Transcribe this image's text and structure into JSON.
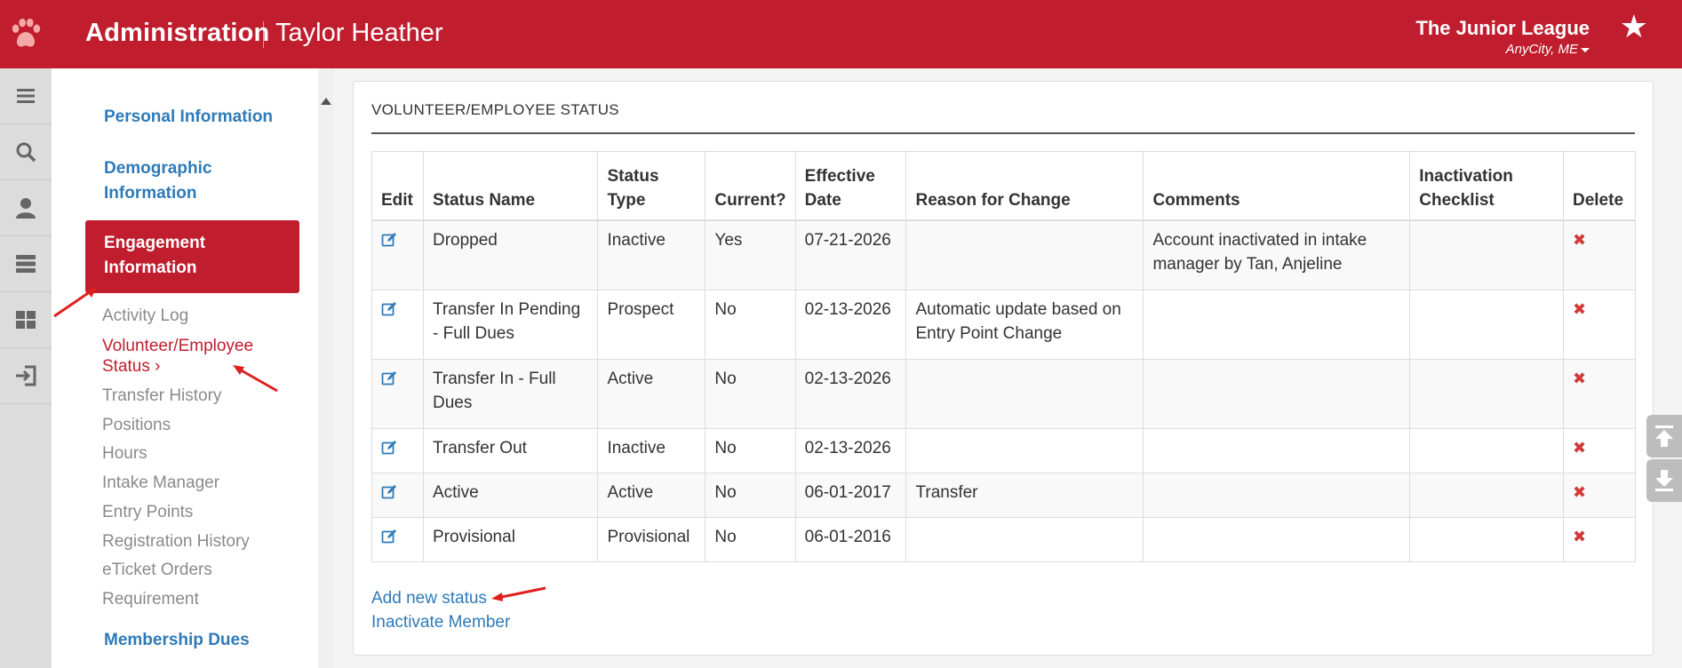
{
  "header": {
    "app_title": "Administration",
    "user_name": "Taylor Heather",
    "org_name": "The Junior League",
    "org_location": "AnyCity, ME",
    "brand_color": "#c01d2e"
  },
  "rail": {
    "icons": [
      "menu-icon",
      "search-icon",
      "user-icon",
      "server-icon",
      "dashboard-icon",
      "logout-icon"
    ]
  },
  "subnav": {
    "personal_information": "Personal Information",
    "demographic_information_line1": "Demographic",
    "demographic_information_line2": "Information",
    "engagement_information_line1": "Engagement",
    "engagement_information_line2": "Information",
    "items": [
      "Activity Log",
      "Volunteer/Employee",
      "Transfer History",
      "Positions",
      "Hours",
      "Intake Manager",
      "Entry Points",
      "Registration History",
      "eTicket Orders",
      "Requirement"
    ],
    "current_item_line2": "Status ›",
    "membership_dues": "Membership Dues"
  },
  "panel": {
    "title": "VOLUNTEER/EMPLOYEE STATUS",
    "columns": {
      "edit": "Edit",
      "status_name": "Status Name",
      "status_type_1": "Status",
      "status_type_2": "Type",
      "current": "Current?",
      "effective_1": "Effective",
      "effective_2": "Date",
      "reason": "Reason for Change",
      "comments": "Comments",
      "inactivation_1": "Inactivation",
      "inactivation_2": "Checklist",
      "delete": "Delete"
    },
    "rows": [
      {
        "status_name": "Dropped",
        "status_type": "Inactive",
        "current": "Yes",
        "effective_date": "07-21-2026",
        "reason": "",
        "comments": "Account inactivated in intake manager by Tan, Anjeline",
        "checklist": ""
      },
      {
        "status_name": "Transfer In Pending - Full Dues",
        "status_type": "Prospect",
        "current": "No",
        "effective_date": "02-13-2026",
        "reason": "Automatic update based on Entry Point Change",
        "comments": "",
        "checklist": ""
      },
      {
        "status_name": "Transfer In - Full Dues",
        "status_type": "Active",
        "current": "No",
        "effective_date": "02-13-2026",
        "reason": "",
        "comments": "",
        "checklist": ""
      },
      {
        "status_name": "Transfer Out",
        "status_type": "Inactive",
        "current": "No",
        "effective_date": "02-13-2026",
        "reason": "",
        "comments": "",
        "checklist": ""
      },
      {
        "status_name": "Active",
        "status_type": "Active",
        "current": "No",
        "effective_date": "06-01-2017",
        "reason": "Transfer",
        "comments": "",
        "checklist": ""
      },
      {
        "status_name": "Provisional",
        "status_type": "Provisional",
        "current": "No",
        "effective_date": "06-01-2016",
        "reason": "",
        "comments": "",
        "checklist": ""
      }
    ],
    "add_new_status": "Add new status",
    "inactivate_member": "Inactivate Member"
  }
}
